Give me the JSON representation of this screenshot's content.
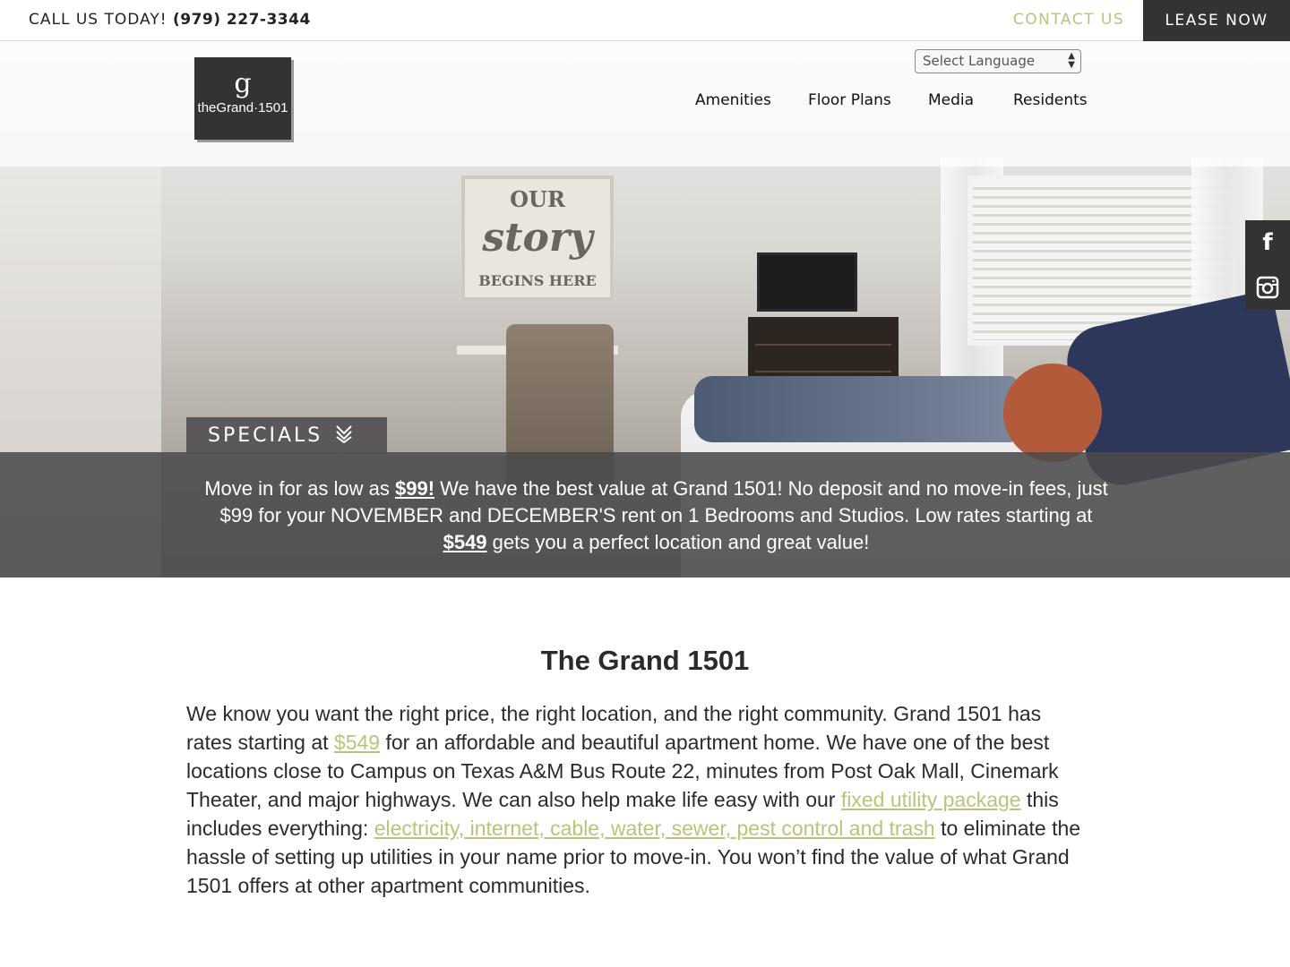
{
  "topbar": {
    "call_label": "CALL US TODAY!",
    "phone": "(979) 227-3344",
    "contact_label": "CONTACT US",
    "lease_label": "LEASE NOW"
  },
  "header": {
    "logo_letter": "g",
    "logo_name": "theGrand·1501",
    "language_select": "Select Language",
    "nav": [
      "Amenities",
      "Floor Plans",
      "Media",
      "Residents"
    ]
  },
  "social": {
    "facebook_glyph": "f",
    "instagram_glyph": "◘"
  },
  "hero": {
    "sign_line1": "OUR",
    "sign_line2": "story",
    "sign_line3": "BEGINS HERE"
  },
  "specials": {
    "tab_label": "SPECIALS",
    "tab_icon": "chevron-double-down",
    "text_1": "Move in for as low as ",
    "price_1": "$99!",
    "text_2": " We have the best value at Grand 1501! No deposit and no move-in fees, just $99 for your NOVEMBER and DECEMBER'S rent on 1 Bedrooms and Studios. Low rates starting at ",
    "price_2": "$549",
    "text_3": " gets you a perfect location and great value!"
  },
  "main": {
    "title": "The Grand 1501",
    "p1": "We know you want the right price, the right location, and the right community. Grand 1501 has rates starting at ",
    "link_price": "$549",
    "p2": " for an affordable and beautiful apartment home. We have one of the best locations close to Campus on Texas A&M Bus Route 22, minutes from Post Oak Mall, Cinemark Theater, and major highways. We can also help make life easy with our ",
    "link_utility": "fixed utility package",
    "p3": " this includes everything: ",
    "link_utilities_list": "electricity, internet, cable, water, sewer, pest control and trash",
    "p4": " to eliminate the hassle of setting up utilities in your name prior to move-in. You won’t find the value of what Grand 1501 offers at other apartment communities."
  },
  "colors": {
    "accent": "#b9c47a",
    "dark": "#333333"
  }
}
